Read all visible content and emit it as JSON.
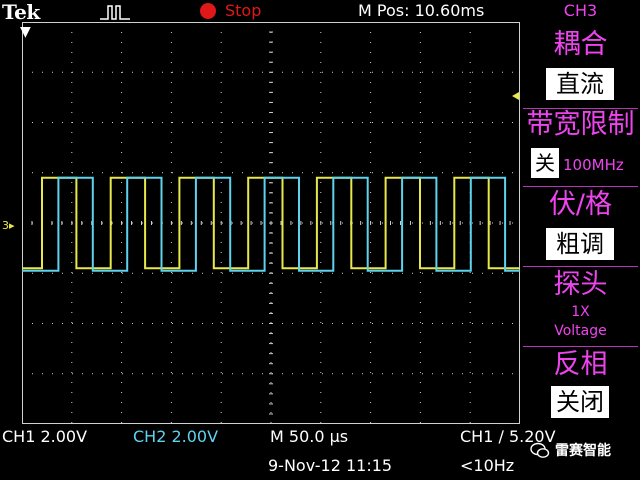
{
  "header": {
    "brand": "Tek",
    "trigger_state": "Stop",
    "m_pos": "M Pos: 10.60ms"
  },
  "menu": {
    "channel": "CH3",
    "coupling_title": "耦合",
    "coupling_value": "直流",
    "bw_title": "带宽限制",
    "bw_value": "关",
    "bw_freq": "100MHz",
    "vdiv_title": "伏/格",
    "vdiv_value": "粗调",
    "probe_title": "探头",
    "probe_ratio": "1X",
    "probe_type": "Voltage",
    "invert_title": "反相",
    "invert_value": "关闭"
  },
  "status": {
    "ch1_scale": "CH1  2.00V",
    "ch2_scale": "CH2  2.00V",
    "timebase": "M 50.0 µs",
    "trigger": "CH1 ∕ 5.20V",
    "date_time": "9-Nov-12 11:15",
    "freq": "<10Hz",
    "watermark": "雷赛智能"
  },
  "colors": {
    "ch1": "#e8e84a",
    "ch2": "#5fd3ee",
    "menu": "#ee44ee",
    "grid": "#d0d0d0",
    "stop": "#e01818"
  },
  "waveforms": {
    "ch1_high_div": 3.1,
    "ch1_low_div": 4.9,
    "ch2_high_div": 3.1,
    "ch2_low_div": 4.95,
    "ch1_period_div": 1.38,
    "duty": 0.5,
    "ch2_lag_div": 0.33
  }
}
